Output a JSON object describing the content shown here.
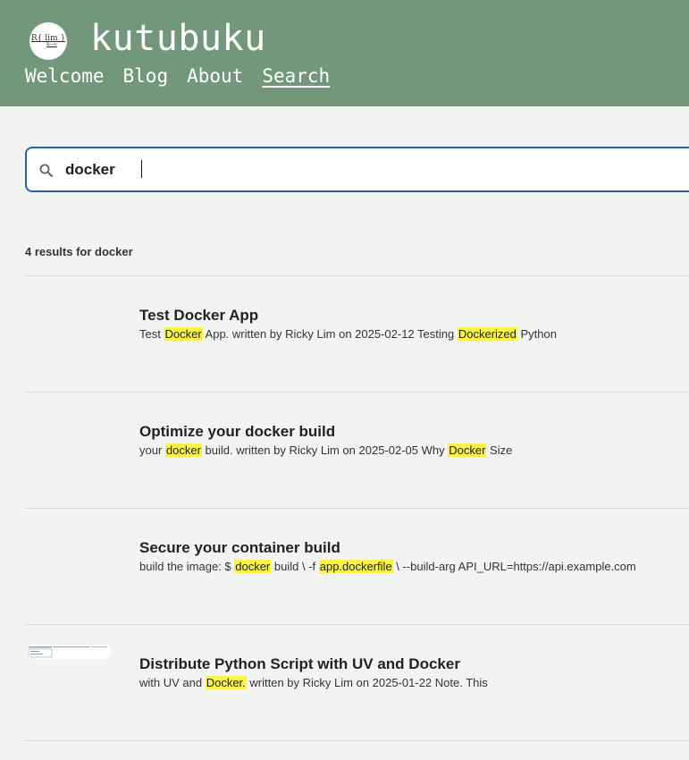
{
  "site": {
    "title": "kutubuku",
    "logo_text": "R{ lim }",
    "logo_subtext": "R→∞"
  },
  "nav": {
    "items": [
      {
        "label": "Welcome"
      },
      {
        "label": "Blog"
      },
      {
        "label": "About"
      },
      {
        "label": "Search",
        "active": true
      }
    ]
  },
  "search": {
    "value": "docker",
    "results_count": "4 results for docker"
  },
  "results": [
    {
      "title": "Test Docker App",
      "excerpt": [
        {
          "text": "Test "
        },
        {
          "text": "Docker",
          "mark": true
        },
        {
          "text": " App. written by Ricky Lim on 2025-02-12 Testing "
        },
        {
          "text": "Dockerized",
          "mark": true
        },
        {
          "text": " Python"
        }
      ],
      "thumbnail": false
    },
    {
      "title": "Optimize your docker build",
      "excerpt": [
        {
          "text": "your "
        },
        {
          "text": "docker",
          "mark": true
        },
        {
          "text": " build. written by Ricky Lim on 2025-02-05 Why "
        },
        {
          "text": "Docker",
          "mark": true
        },
        {
          "text": " Size"
        }
      ],
      "thumbnail": false
    },
    {
      "title": "Secure your container build",
      "excerpt": [
        {
          "text": "build the image: $ "
        },
        {
          "text": "docker",
          "mark": true
        },
        {
          "text": " build \\ -f "
        },
        {
          "text": "app.dockerfile",
          "mark": true
        },
        {
          "text": " \\ --build-arg API_URL=https://api.example.com"
        }
      ],
      "thumbnail": false
    },
    {
      "title": "Distribute Python Script with UV and Docker",
      "excerpt": [
        {
          "text": "with UV and "
        },
        {
          "text": "Docker.",
          "mark": true
        },
        {
          "text": " written by Ricky Lim on 2025-01-22 Note. This"
        }
      ],
      "thumbnail": true
    }
  ],
  "colors": {
    "header_bg": "#72977a",
    "page_bg": "#f2f4f2",
    "focus_border": "#2a62a8",
    "highlight": "#fbf24b"
  }
}
